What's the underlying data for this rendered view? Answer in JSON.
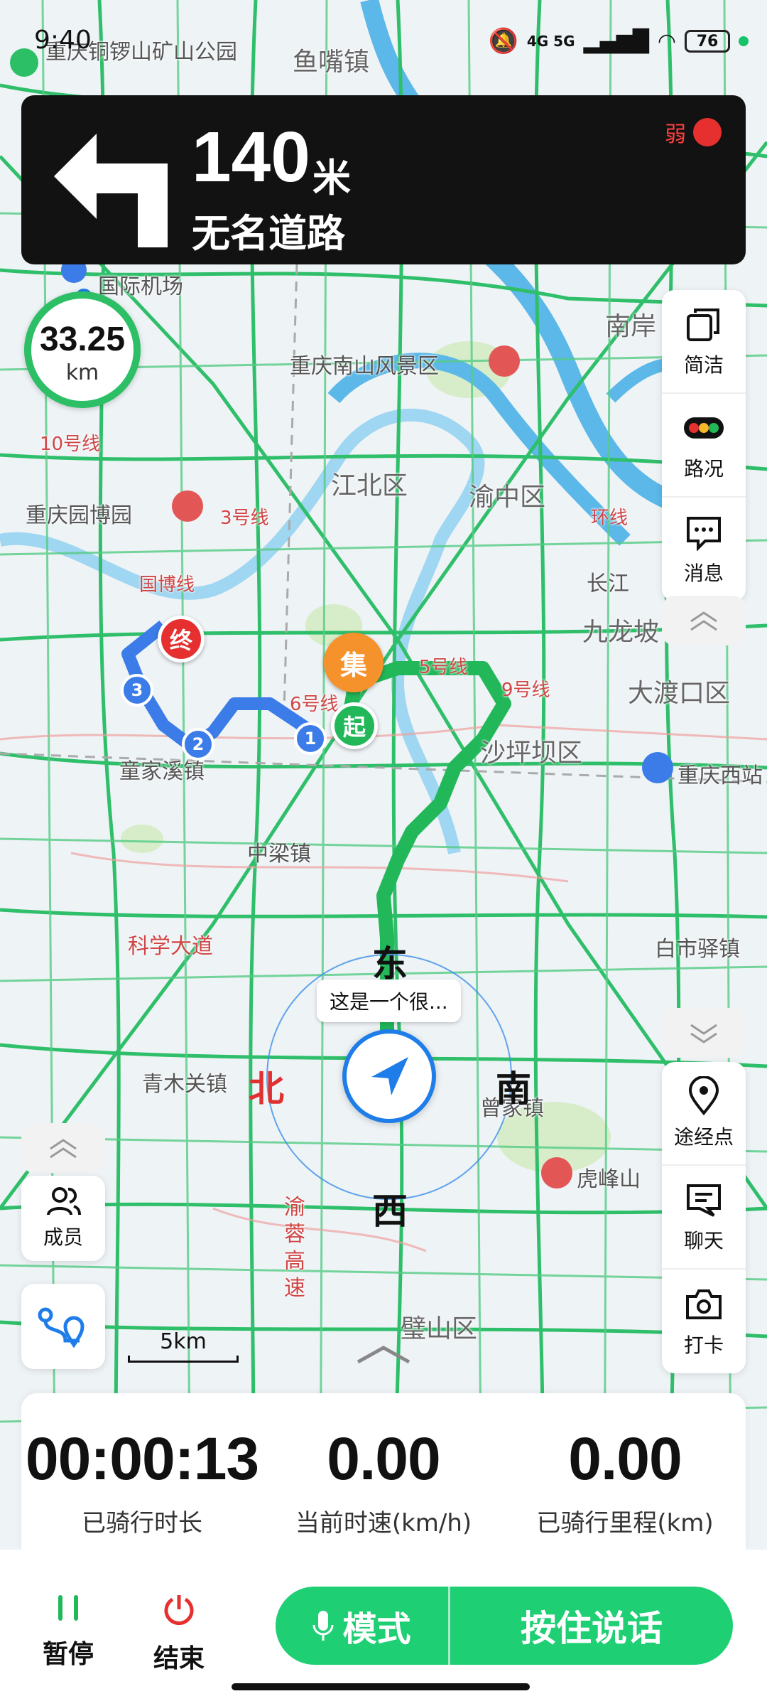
{
  "status_bar": {
    "time": "9:40",
    "network": "4G 5G",
    "battery": "76"
  },
  "navigation": {
    "distance": "140",
    "distance_unit": "米",
    "road_name": "无名道路",
    "signal_label": "弱"
  },
  "remaining": {
    "value": "33.25",
    "unit": "km"
  },
  "map": {
    "labels": {
      "park": "重庆铜锣山矿山公园",
      "town1": "鱼嘴镇",
      "airport": "国际机场",
      "scenic": "重庆南山风景区",
      "line10": "10号线",
      "jiangbei": "江北区",
      "yuzhong": "渝中区",
      "expo": "重庆园博园",
      "line3": "3号线",
      "huanxian": "环线",
      "changjiang": "长江",
      "guobo": "国博线",
      "jiulongpo": "九龙坡",
      "line5": "5号线",
      "line6": "6号线",
      "line9": "9号线",
      "dadukou": "大渡口区",
      "shapingba": "沙坪坝区",
      "tongjiaxi": "童家溪镇",
      "chongqing_west": "重庆西站",
      "zhongliang": "中梁镇",
      "kexue": "科学大道",
      "baishiyi": "白市驿镇",
      "qingmuguan": "青木关镇",
      "zengjia": "曾家镇",
      "hufengshan": "虎峰山",
      "yurong": "渝蓉高速",
      "bishan": "璧山区",
      "nanan": "南岸"
    },
    "markers": {
      "end": "终",
      "start": "起",
      "gather": "集",
      "waypoint1": "1",
      "waypoint2": "2",
      "waypoint3": "3"
    },
    "compass": {
      "east": "东",
      "north": "北",
      "south": "南",
      "west": "西"
    },
    "bubble_text": "这是一个很...",
    "scale": "5km"
  },
  "toolbar_top": [
    {
      "label": "简洁"
    },
    {
      "label": "路况"
    },
    {
      "label": "消息"
    }
  ],
  "toolbar_bottom": [
    {
      "label": "途经点"
    },
    {
      "label": "聊天"
    },
    {
      "label": "打卡"
    }
  ],
  "left_tools": {
    "members": "成员"
  },
  "stats": [
    {
      "value": "00:00:13",
      "label": "已骑行时长"
    },
    {
      "value": "0.00",
      "label": "当前时速(km/h)"
    },
    {
      "value": "0.00",
      "label": "已骑行里程(km)"
    }
  ],
  "bottom": {
    "pause": "暂停",
    "end": "结束",
    "mode": "模式",
    "talk": "按住说话"
  },
  "colors": {
    "route_green": "#22b85a",
    "route_blue": "#3c7ce8",
    "accent_green": "#1fcf74",
    "nav_panel": "#121212"
  }
}
